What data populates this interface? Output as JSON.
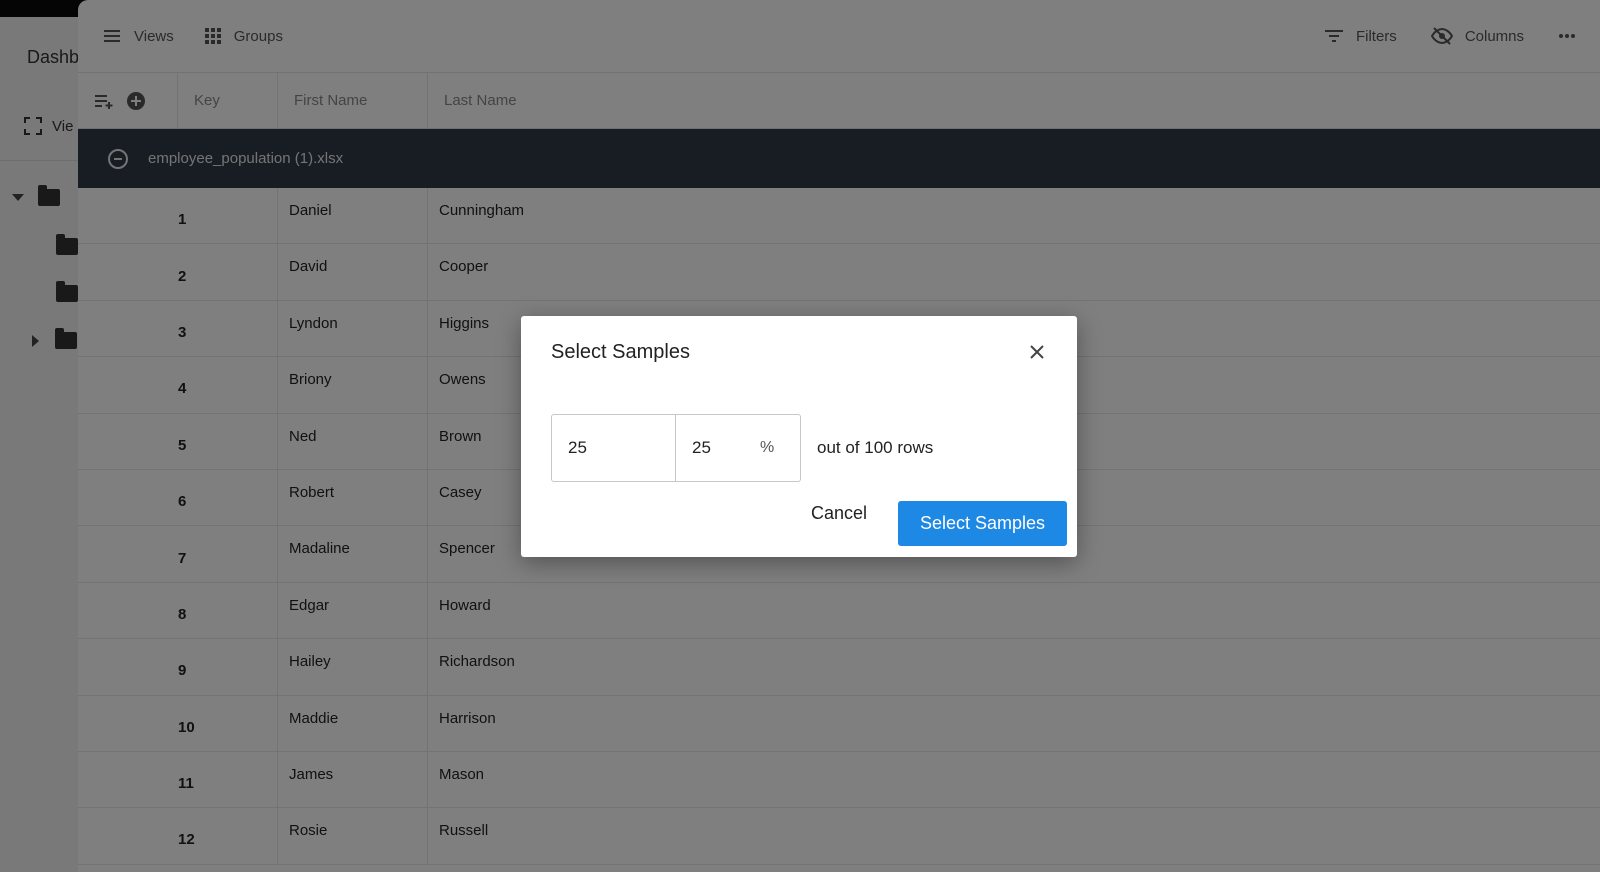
{
  "sidebar": {
    "title": "Dashb",
    "view_label": "Vie"
  },
  "toolbar": {
    "views_label": "Views",
    "groups_label": "Groups",
    "filters_label": "Filters",
    "columns_label": "Columns"
  },
  "table": {
    "headers": {
      "key": "Key",
      "first_name": "First Name",
      "last_name": "Last Name"
    },
    "group_label": "employee_population (1).xlsx",
    "rows": [
      {
        "key": "1",
        "first": "Daniel",
        "last": "Cunningham"
      },
      {
        "key": "2",
        "first": "David",
        "last": "Cooper"
      },
      {
        "key": "3",
        "first": "Lyndon",
        "last": "Higgins"
      },
      {
        "key": "4",
        "first": "Briony",
        "last": "Owens"
      },
      {
        "key": "5",
        "first": "Ned",
        "last": "Brown"
      },
      {
        "key": "6",
        "first": "Robert",
        "last": "Casey"
      },
      {
        "key": "7",
        "first": "Madaline",
        "last": "Spencer"
      },
      {
        "key": "8",
        "first": "Edgar",
        "last": "Howard"
      },
      {
        "key": "9",
        "first": "Hailey",
        "last": "Richardson"
      },
      {
        "key": "10",
        "first": "Maddie",
        "last": "Harrison"
      },
      {
        "key": "11",
        "first": "James",
        "last": "Mason"
      },
      {
        "key": "12",
        "first": "Rosie",
        "last": "Russell"
      }
    ]
  },
  "modal": {
    "title": "Select Samples",
    "count_value": "25",
    "percent_value": "25",
    "percent_sign": "%",
    "out_of_text": "out of 100 rows",
    "cancel_label": "Cancel",
    "confirm_label": "Select Samples"
  },
  "colors": {
    "accent": "#1e88e5",
    "group_row_bg": "#313a49"
  }
}
